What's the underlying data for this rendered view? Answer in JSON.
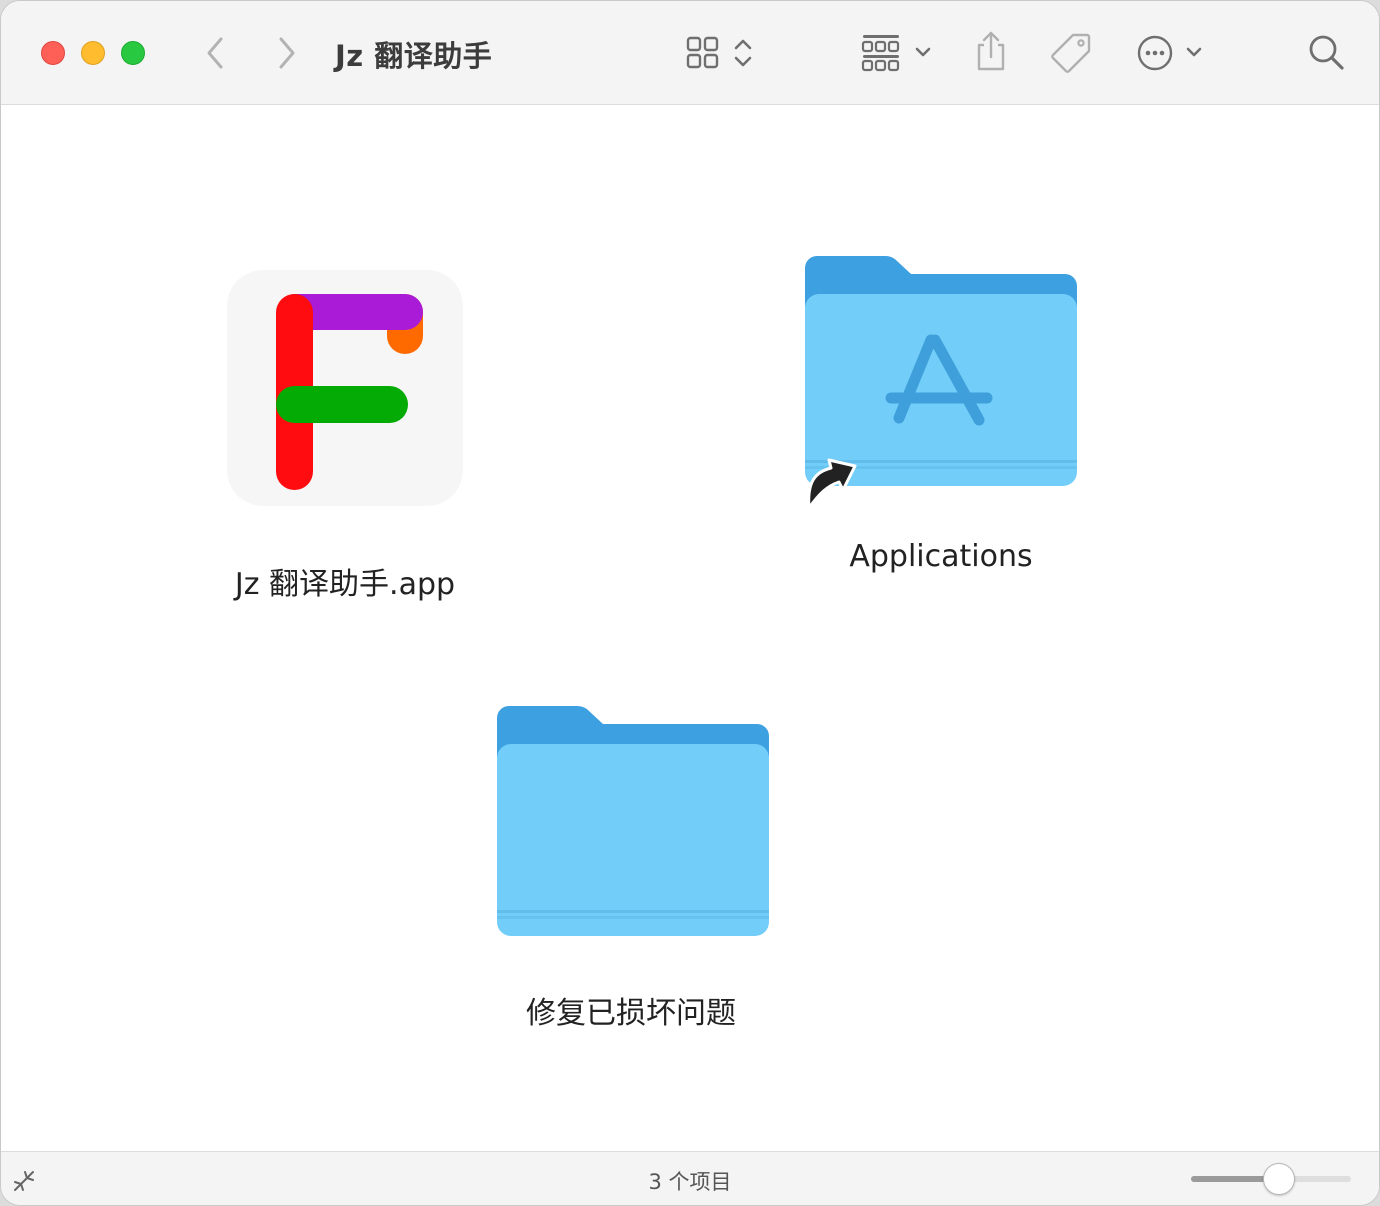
{
  "window": {
    "title": "Jz 翻译助手"
  },
  "toolbar": {
    "icons": {
      "back": "chevron-left-icon",
      "forward": "chevron-right-icon",
      "view_grid": "icon-grid-icon",
      "group": "group-icon",
      "share": "share-icon",
      "tag": "tag-icon",
      "more": "more-icon",
      "search": "search-icon"
    }
  },
  "items": [
    {
      "label": "Jz 翻译助手.app",
      "kind": "app"
    },
    {
      "label": "Applications",
      "kind": "alias-folder"
    },
    {
      "label": "修复已损坏问题",
      "kind": "folder"
    }
  ],
  "statusbar": {
    "count_text": "3 个项目",
    "icon_size_level": 0.55
  },
  "colors": {
    "folder_light": "#72cdf9",
    "folder_dark": "#3da0e0",
    "logo_red": "#ff0c10",
    "logo_purple": "#a91bd6",
    "logo_orange": "#ff6a00",
    "logo_green": "#05ab05"
  }
}
